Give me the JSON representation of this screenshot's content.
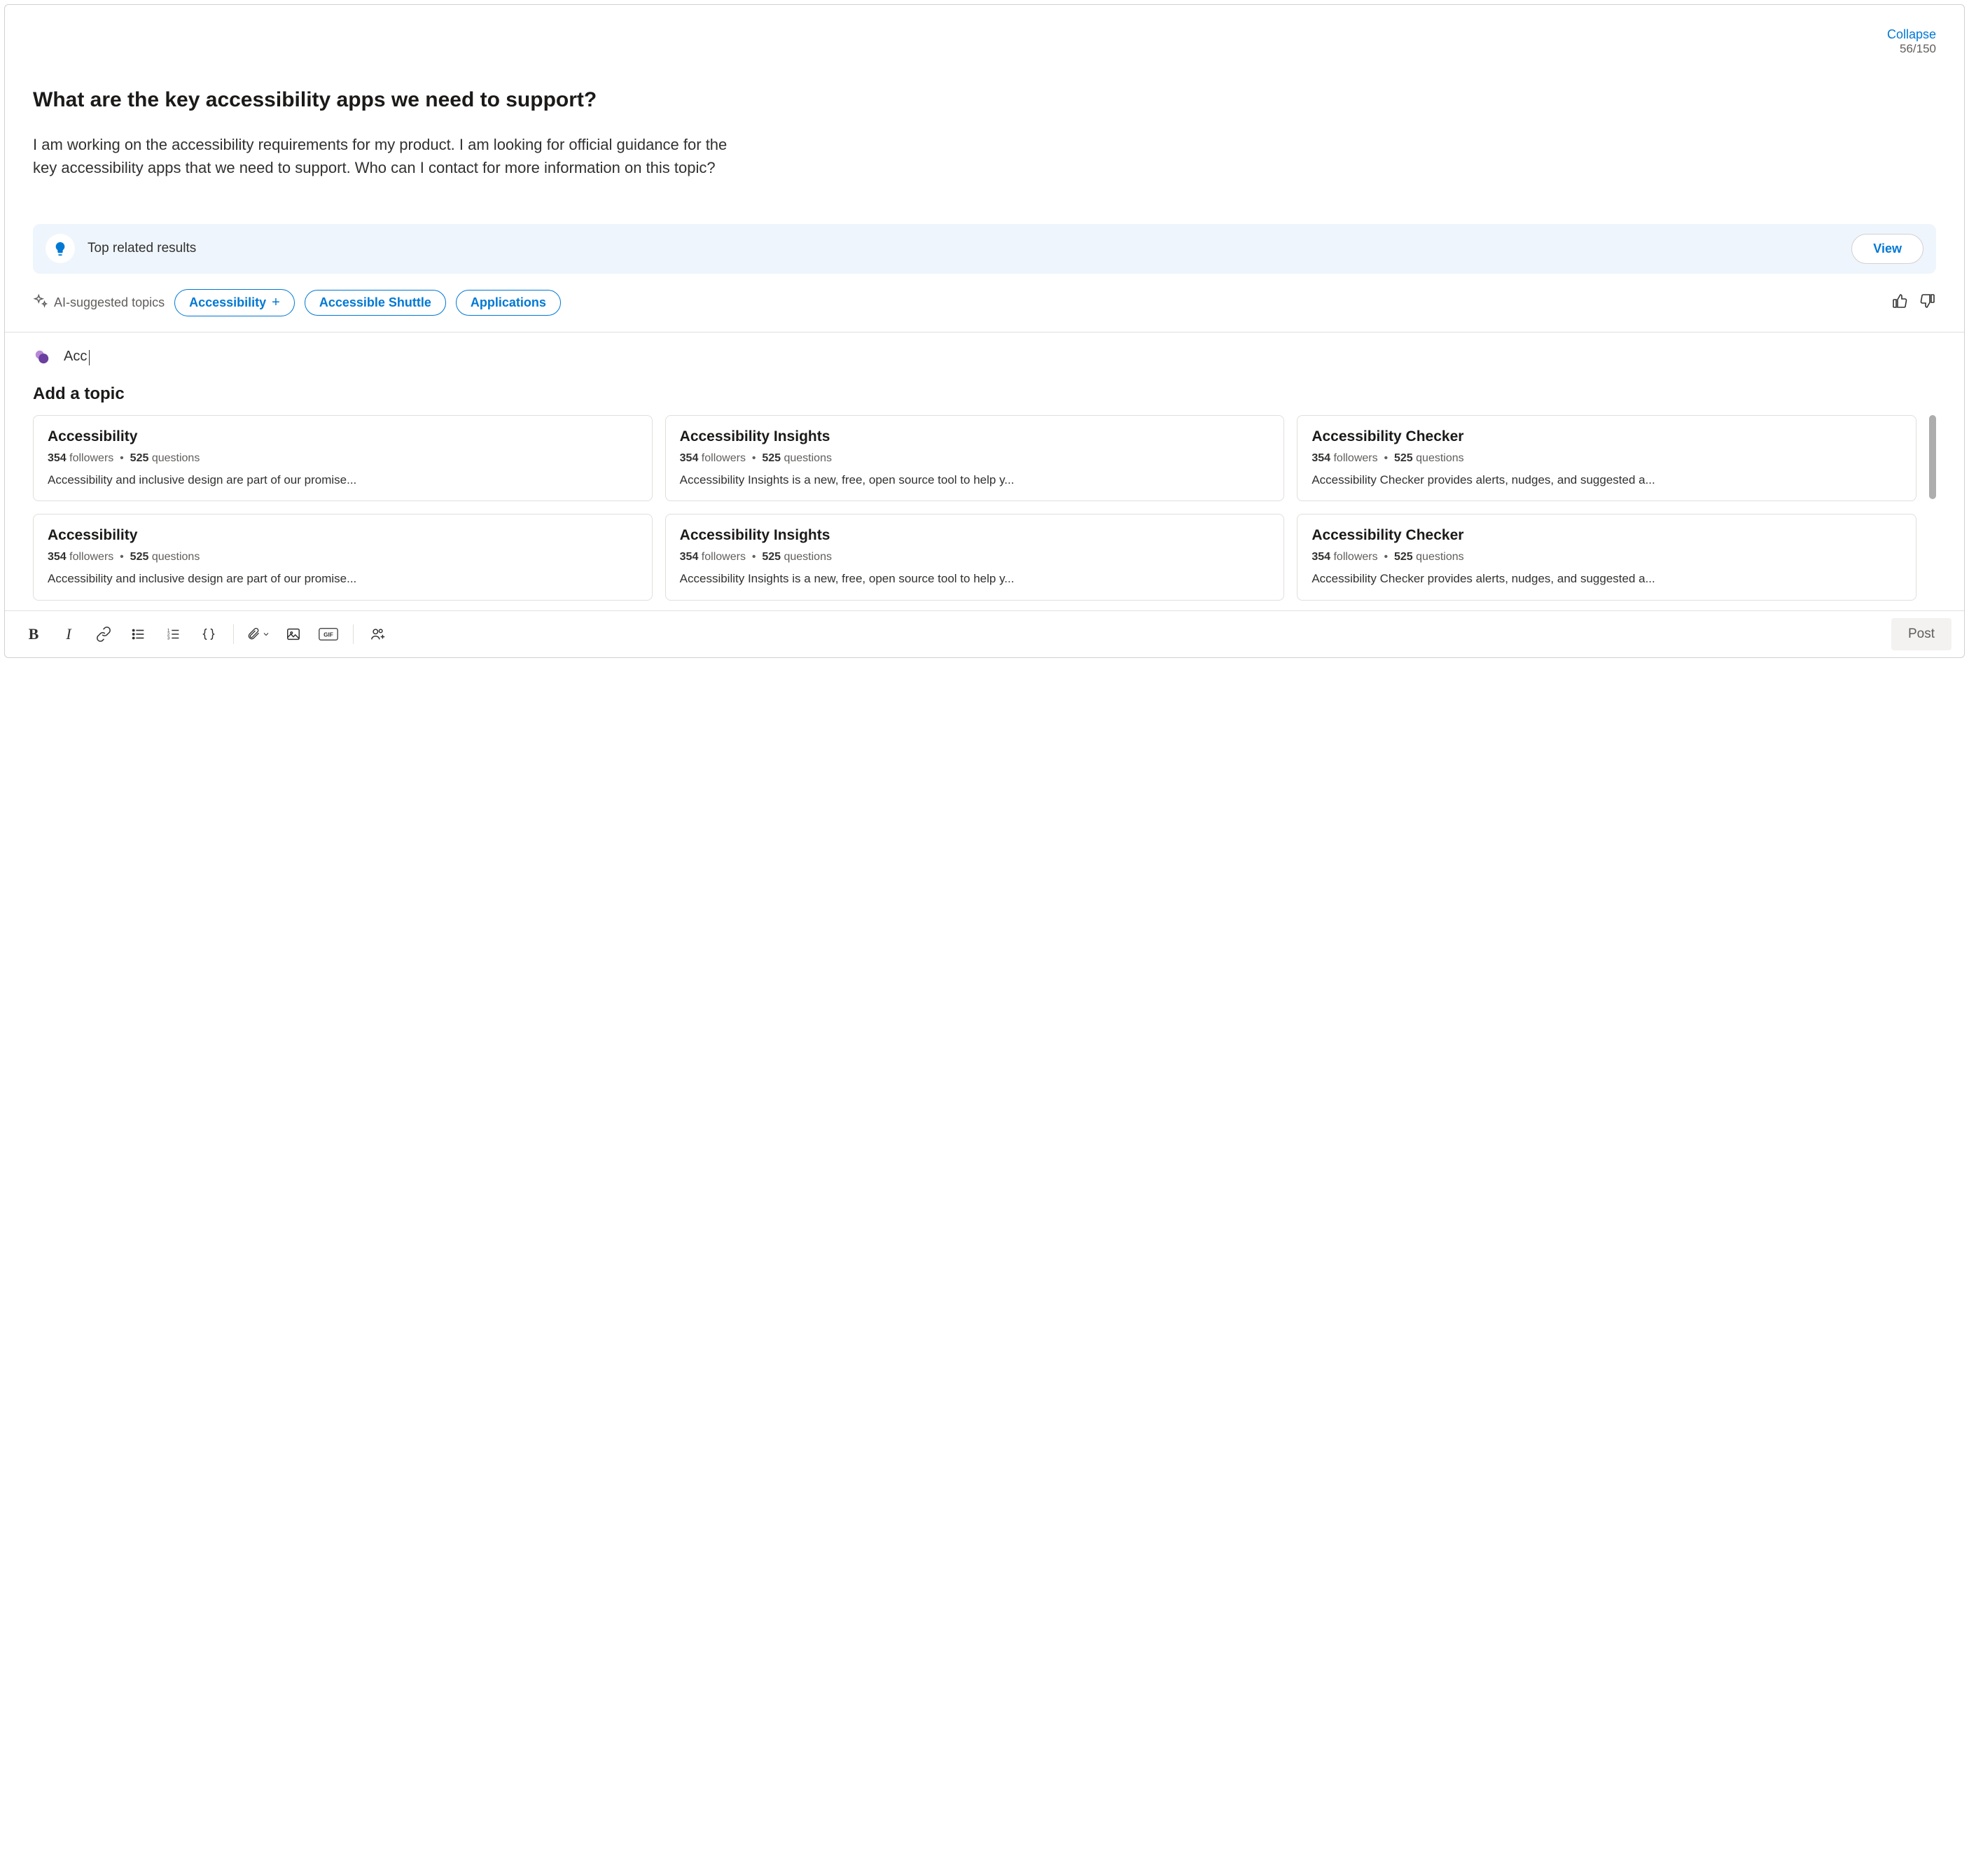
{
  "header": {
    "collapse": "Collapse",
    "counter": "56/150"
  },
  "question": {
    "title": "What are the key accessibility apps we need to support?",
    "body": "I am working on the accessibility requirements for my product. I am looking for official guidance for the key accessibility apps that we need to support. Who can I contact for more information on this topic?"
  },
  "related": {
    "label": "Top related results",
    "view": "View"
  },
  "suggested": {
    "label": "AI-suggested topics",
    "chips": [
      {
        "label": "Accessibility",
        "has_plus": true
      },
      {
        "label": "Accessible Shuttle",
        "has_plus": false
      },
      {
        "label": "Applications",
        "has_plus": false
      }
    ]
  },
  "topic_input": {
    "value": "Acc",
    "heading": "Add a topic"
  },
  "topic_cards": [
    {
      "title": "Accessibility",
      "followers": "354",
      "followers_label": "followers",
      "questions": "525",
      "questions_label": "questions",
      "desc": "Accessibility and inclusive design are part of our promise..."
    },
    {
      "title": "Accessibility Insights",
      "followers": "354",
      "followers_label": "followers",
      "questions": "525",
      "questions_label": "questions",
      "desc": "Accessibility Insights is a new, free, open source tool to help y..."
    },
    {
      "title": "Accessibility Checker",
      "followers": "354",
      "followers_label": "followers",
      "questions": "525",
      "questions_label": "questions",
      "desc": "Accessibility Checker provides alerts, nudges, and suggested a..."
    },
    {
      "title": "Accessibility",
      "followers": "354",
      "followers_label": "followers",
      "questions": "525",
      "questions_label": "questions",
      "desc": "Accessibility and inclusive design are part of our promise..."
    },
    {
      "title": "Accessibility Insights",
      "followers": "354",
      "followers_label": "followers",
      "questions": "525",
      "questions_label": "questions",
      "desc": "Accessibility Insights is a new, free, open source tool to help y..."
    },
    {
      "title": "Accessibility Checker",
      "followers": "354",
      "followers_label": "followers",
      "questions": "525",
      "questions_label": "questions",
      "desc": "Accessibility Checker provides alerts, nudges, and suggested a..."
    }
  ],
  "toolbar": {
    "post": "Post",
    "gif_label": "GIF"
  }
}
